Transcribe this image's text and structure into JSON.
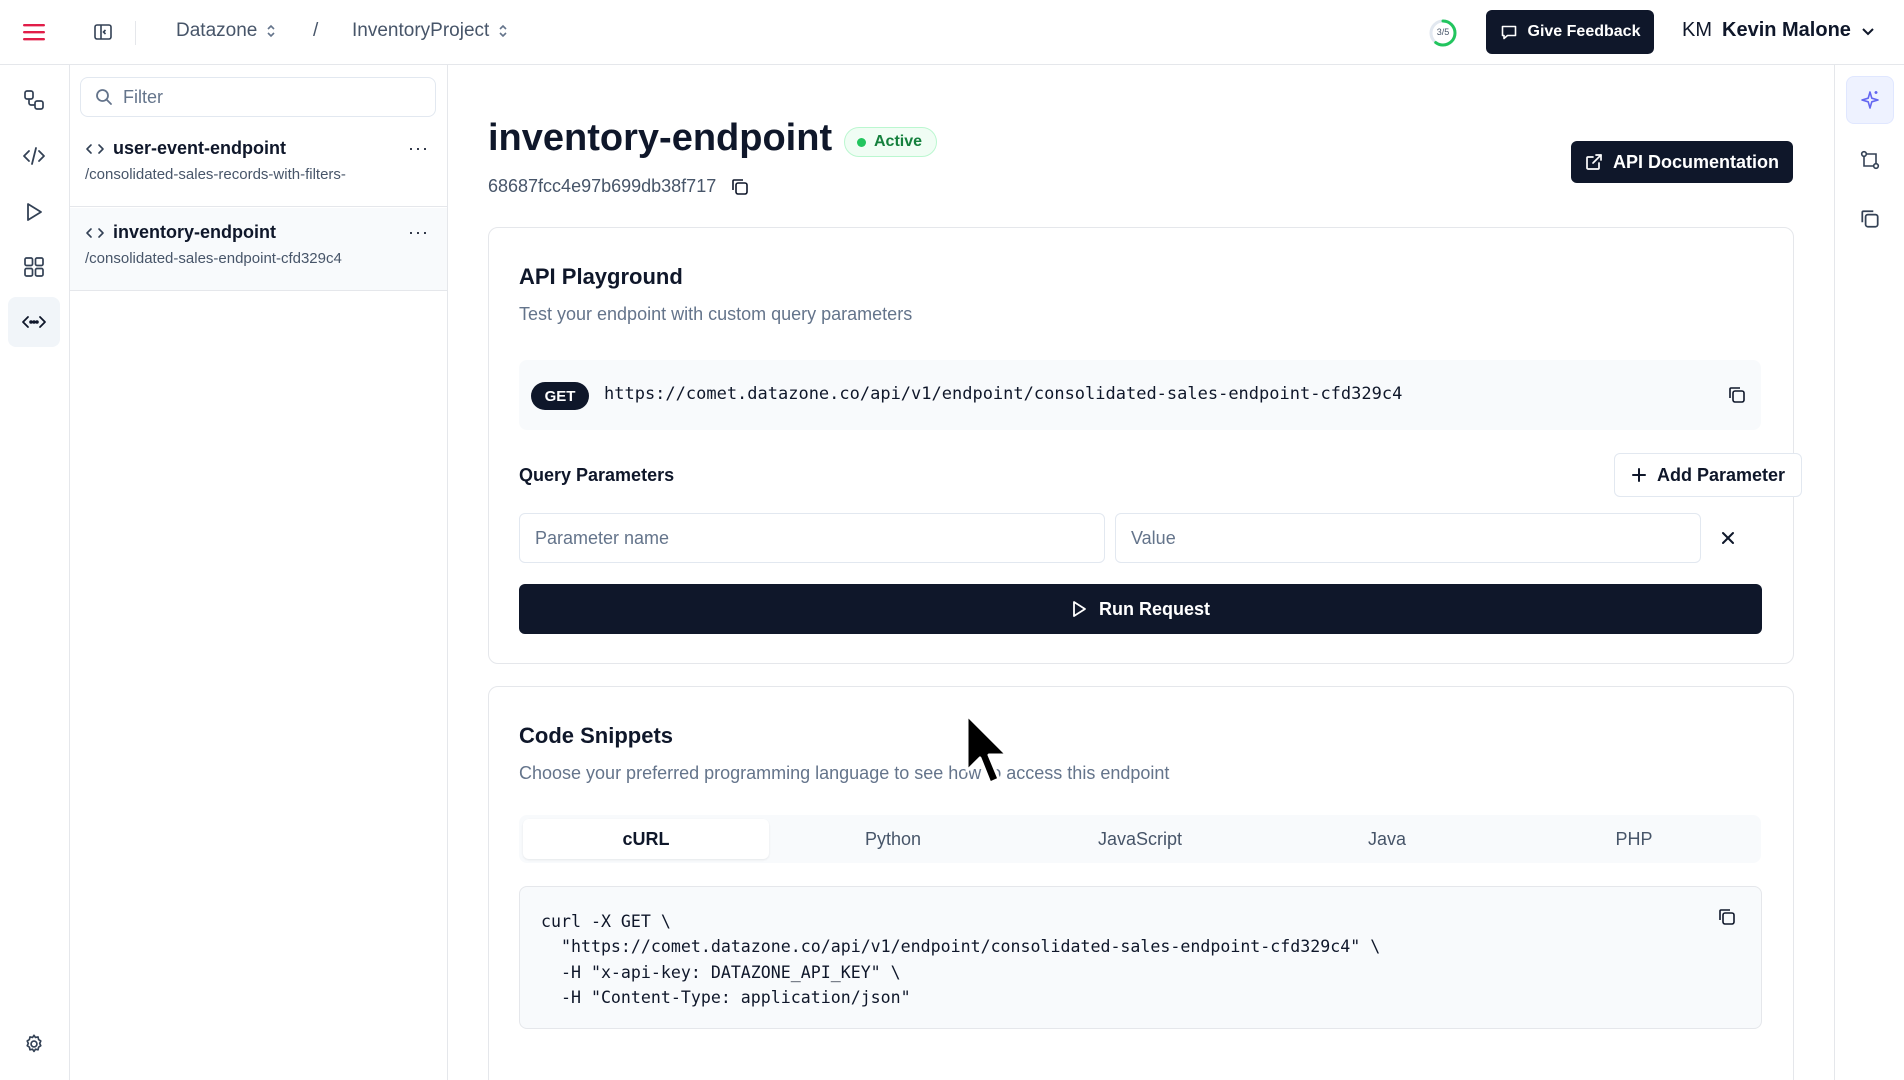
{
  "header": {
    "workspace": "Datazone",
    "separator": "/",
    "project": "InventoryProject",
    "progress_label": "3/5",
    "progress_fraction": 0.6,
    "feedback_label": "Give Feedback",
    "user_initials": "KM",
    "user_name": "Kevin Malone"
  },
  "list": {
    "filter_placeholder": "Filter",
    "endpoints": [
      {
        "name": "user-event-endpoint",
        "path": "/consolidated-sales-records-with-filters-",
        "more": "···"
      },
      {
        "name": "inventory-endpoint",
        "path": "/consolidated-sales-endpoint-cfd329c4",
        "more": "···"
      }
    ]
  },
  "main": {
    "title": "inventory-endpoint",
    "status": "Active",
    "endpoint_id": "68687fcc4e97b699db38f717",
    "api_doc_label": "API Documentation",
    "playground": {
      "title": "API Playground",
      "subtitle": "Test your endpoint with custom query parameters",
      "method": "GET",
      "url": "https://comet.datazone.co/api/v1/endpoint/consolidated-sales-endpoint-cfd329c4",
      "query_params_label": "Query Parameters",
      "add_param_label": "Add Parameter",
      "param_name_placeholder": "Parameter name",
      "param_value_placeholder": "Value",
      "run_label": "Run Request"
    },
    "snippets": {
      "title": "Code Snippets",
      "subtitle": "Choose your preferred programming language to see how to access this endpoint",
      "tabs": [
        "cURL",
        "Python",
        "JavaScript",
        "Java",
        "PHP"
      ],
      "active_tab": "cURL",
      "code": "curl -X GET \\\n  \"https://comet.datazone.co/api/v1/endpoint/consolidated-sales-endpoint-cfd329c4\" \\\n  -H \"x-api-key: DATAZONE_API_KEY\" \\\n  -H \"Content-Type: application/json\""
    }
  },
  "colors": {
    "brand_dark": "#0f172a",
    "menu_icon": "#e11d48",
    "active_green": "#22c55e",
    "muted_text": "#64748b",
    "ai_accent": "#6366f1"
  },
  "icons": {
    "menu": "hamburger-menu-icon",
    "panel": "sidebar-toggle-icon",
    "feedback": "message-square-icon",
    "rail": [
      "workflow-icon",
      "code-icon",
      "play-icon",
      "grid-icon",
      "api-endpoint-icon",
      "settings-gear-icon"
    ],
    "right_rail": [
      "sparkles-icon",
      "git-compare-icon",
      "copy-icon"
    ]
  }
}
